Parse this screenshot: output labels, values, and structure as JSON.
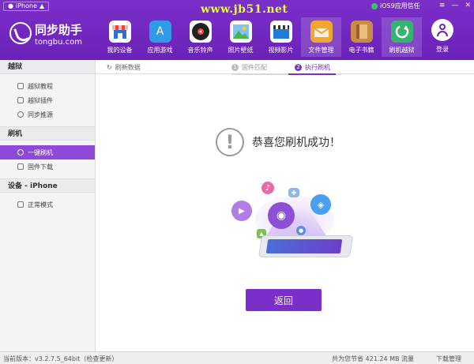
{
  "topbar": {
    "device_label": "iPhone",
    "watermark": "www.jb51.net",
    "trust_label": "iOS9应用信任"
  },
  "logo": {
    "cn": "同步助手",
    "en": "tongbu.com"
  },
  "nav": [
    {
      "label": "我的设备",
      "icon": "store-icon",
      "color": "#e9473b"
    },
    {
      "label": "应用游戏",
      "icon": "app-store-icon",
      "color": "#2f9be8"
    },
    {
      "label": "音乐铃声",
      "icon": "music-disc-icon",
      "color": "#222222"
    },
    {
      "label": "照片壁纸",
      "icon": "photo-icon",
      "color": "#49b64a"
    },
    {
      "label": "视频影片",
      "icon": "clapper-icon",
      "color": "#1f7ed6"
    },
    {
      "label": "文件管理",
      "icon": "folder-icon",
      "color": "#f0a631"
    },
    {
      "label": "电子书籍",
      "icon": "book-icon",
      "color": "#c98b48"
    },
    {
      "label": "刷机越狱",
      "icon": "refresh-icon",
      "color": "#36b36e"
    }
  ],
  "login_label": "登录",
  "sidebar": {
    "sections": [
      {
        "title": "越狱",
        "items": [
          "越狱教程",
          "越狱插件",
          "同步推源"
        ]
      },
      {
        "title": "刷机",
        "items": [
          "一键刷机",
          "固件下载"
        ]
      },
      {
        "title": "设备 - iPhone",
        "items": [
          "正常模式"
        ]
      }
    ],
    "active_item": "一键刷机"
  },
  "crumb": {
    "refresh": "刷新数据",
    "step1_num": "1",
    "step1": "固件匹配",
    "step2_num": "2",
    "step2": "执行刷机"
  },
  "main": {
    "success_text": "恭喜您刷机成功！",
    "back_label": "返回"
  },
  "status": {
    "version": "当前版本：v3.2.7.5_64bit（检查更新）",
    "saved": "共为您节省   421.24 MB 流量",
    "download": "下载管理"
  }
}
